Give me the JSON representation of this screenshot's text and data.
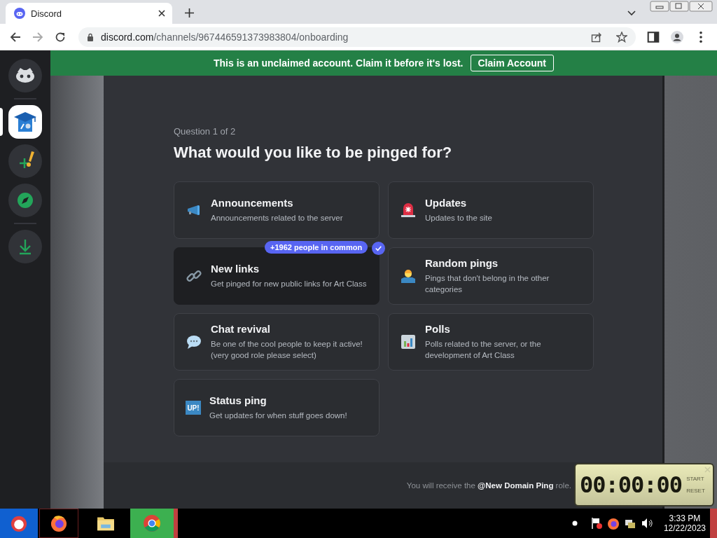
{
  "browser": {
    "tab_title": "Discord",
    "url_host": "discord.com",
    "url_path": "/channels/967446591373983804/onboarding"
  },
  "server_rail": [
    {
      "kind": "home",
      "selected": false
    },
    {
      "kind": "server",
      "selected": true
    },
    {
      "kind": "add",
      "selected": false
    },
    {
      "kind": "explore",
      "selected": false
    },
    {
      "kind": "download",
      "selected": false
    }
  ],
  "banner": {
    "text": "This is an unclaimed account. Claim it before it's lost.",
    "button": "Claim Account"
  },
  "onboarding": {
    "step": "Question 1 of 2",
    "title": "What would you like to be pinged for?",
    "options": [
      {
        "kind": "megaphone",
        "title": "Announcements",
        "description": "Announcements related to the server",
        "selected": false
      },
      {
        "kind": "siren",
        "title": "Updates",
        "description": "Updates to the site",
        "selected": false
      },
      {
        "kind": "link",
        "title": "New links",
        "description": "Get pinged for new public links for Art Class",
        "selected": true,
        "badge": "+1962 people in common"
      },
      {
        "kind": "shrug",
        "title": "Random pings",
        "description": "Pings that don't belong in the other categories",
        "selected": false
      },
      {
        "kind": "speech",
        "title": "Chat revival",
        "description": "Be one of the cool people to keep it active! (very good role please select)",
        "selected": false
      },
      {
        "kind": "chart",
        "title": "Polls",
        "description": "Polls related to the server, or the development of Art Class",
        "selected": false
      },
      {
        "kind": "up",
        "icon_label": "UP!",
        "title": "Status ping",
        "description": "Get updates for when stuff goes down!",
        "selected": false
      }
    ],
    "footer": "You will receive the **@New Domain Ping** role."
  },
  "timer": {
    "display": "00:00:00",
    "buttons": [
      "START",
      "RESET"
    ]
  },
  "taskbar": {
    "apps": [
      {
        "kind": "start"
      },
      {
        "kind": "firefox"
      },
      {
        "kind": "folder"
      },
      {
        "kind": "chrome"
      }
    ],
    "time": "3:33 PM",
    "date": "12/22/2023"
  }
}
